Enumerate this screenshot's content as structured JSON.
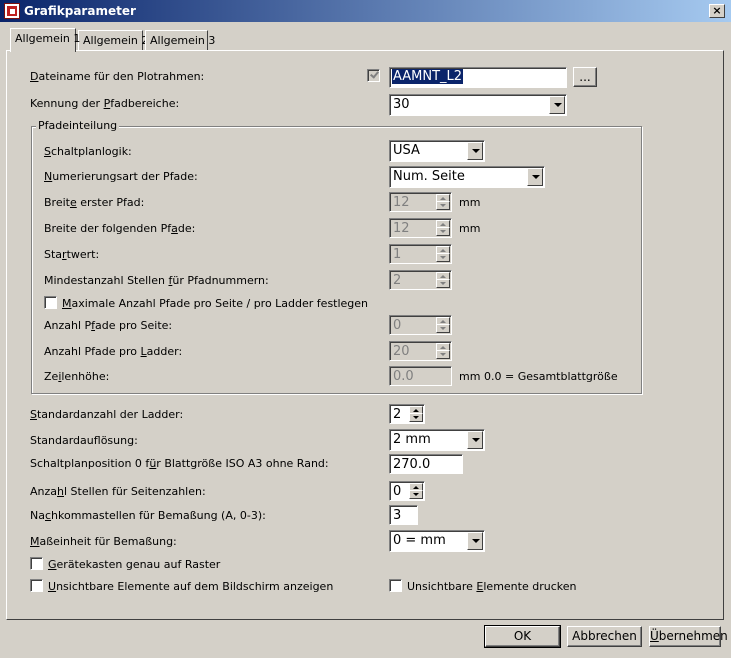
{
  "window": {
    "title": "Grafikparameter",
    "close_glyph": "×"
  },
  "tabs": [
    {
      "label": "Allgemein 1",
      "active": true
    },
    {
      "label": "Allgemein 2",
      "active": false
    },
    {
      "label": "Allgemein 3",
      "active": false
    }
  ],
  "form": {
    "plotframe": {
      "label_pre": "",
      "label_u": "D",
      "label_post": "ateiname für den Plotrahmen:",
      "value": "AAMNT_L2",
      "browse": "...",
      "checked": true
    },
    "pathid": {
      "label_pre": "Kennung der ",
      "label_u": "P",
      "label_post": "fadbereiche:",
      "value": "30"
    },
    "group": {
      "title": "Pfadeinteilung",
      "logic": {
        "label_pre": "",
        "label_u": "S",
        "label_post": "chaltplanlogik:",
        "value": "USA"
      },
      "numbering": {
        "label_pre": "",
        "label_u": "N",
        "label_post": "umerierungsart der Pfade:",
        "value": "Num. Seite"
      },
      "first_width": {
        "label_pre": "Breit",
        "label_u": "e",
        "label_post": " erster Pfad:",
        "value": "12",
        "unit": "mm"
      },
      "next_width": {
        "label_pre": "Breite der folgenden Pf",
        "label_u": "a",
        "label_post": "de:",
        "value": "12",
        "unit": "mm"
      },
      "start": {
        "label_pre": "Sta",
        "label_u": "r",
        "label_post": "twert:",
        "value": "1"
      },
      "min_digits": {
        "label_pre": "Mindestanzahl Stellen ",
        "label_u": "f",
        "label_post": "ür Pfadnummern:",
        "value": "2"
      },
      "max_paths": {
        "label_pre": "",
        "label_u": "M",
        "label_post": "aximale Anzahl Pfade pro Seite / pro Ladder festlegen",
        "checked": false
      },
      "per_page": {
        "label_pre": "Anzahl P",
        "label_u": "f",
        "label_post": "ade pro Seite:",
        "value": "0"
      },
      "per_ladder": {
        "label_pre": "Anzahl Pfade pro ",
        "label_u": "L",
        "label_post": "adder:",
        "value": "20"
      },
      "row_height": {
        "label_pre": "Ze",
        "label_u": "i",
        "label_post": "lenhöhe:",
        "value": "0.0",
        "unit": "mm",
        "note": "0.0 = Gesamtblattgröße"
      }
    },
    "ladder_count": {
      "label_pre": "",
      "label_u": "S",
      "label_post": "tandardanzahl der Ladder:",
      "value": "2"
    },
    "resolution": {
      "label_pre": "Standardauf",
      "label_u": "l",
      "label_post": "ösung:",
      "value": "2 mm"
    },
    "position0": {
      "label_pre": "Schaltplanposition 0 f",
      "label_u": "ü",
      "label_post": "r Blattgröße ISO A3 ohne Rand:",
      "value": "270.0"
    },
    "page_digits": {
      "label_pre": "Anza",
      "label_u": "h",
      "label_post": "l Stellen für Seitenzahlen:",
      "value": "0"
    },
    "decimals": {
      "label_pre": "Na",
      "label_u": "c",
      "label_post": "hkommastellen für Bemaßung (A, 0-3):",
      "value": "3"
    },
    "unit": {
      "label_pre": "",
      "label_u": "M",
      "label_post": "aßeinheit für Bemaßung:",
      "value": "0 = mm"
    },
    "snap": {
      "label_pre": "",
      "label_u": "G",
      "label_post": "erätekasten genau auf Raster",
      "checked": false
    },
    "show_invisible": {
      "label_pre": "",
      "label_u": "U",
      "label_post": "nsichtbare Elemente auf dem Bildschirm anzeigen",
      "checked": false
    },
    "print_invisible": {
      "label_pre": "Unsichtbare ",
      "label_u": "E",
      "label_post": "lemente drucken",
      "checked": false
    }
  },
  "buttons": {
    "ok": "OK",
    "cancel": "Abbrechen",
    "apply_pre": "",
    "apply_u": "Ü",
    "apply_post": "bernehmen"
  }
}
